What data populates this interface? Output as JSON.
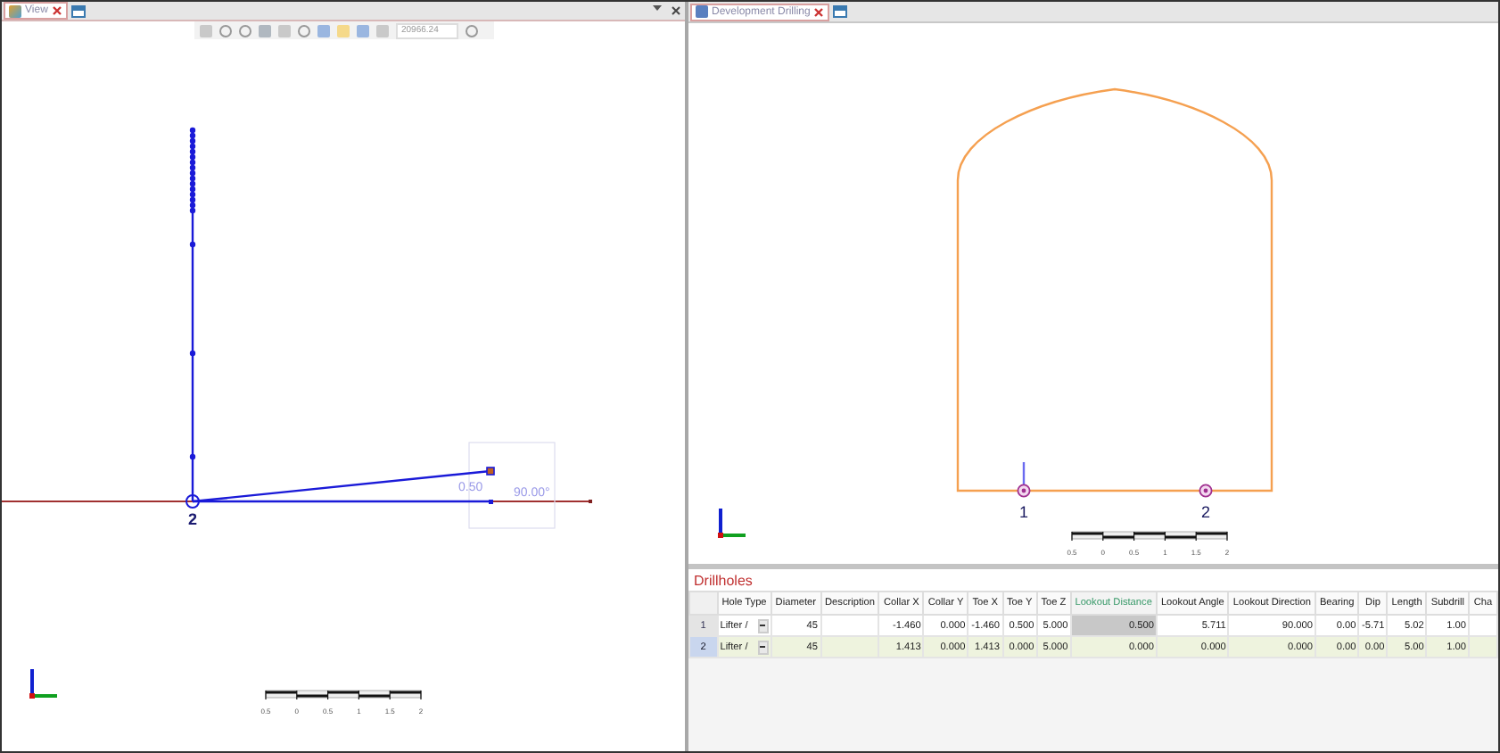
{
  "left_pane": {
    "tab": {
      "label": "View",
      "selected": true
    },
    "toolbar": {
      "scale": "20966.24"
    },
    "hole_label": "2",
    "distance_label": "0.50",
    "angle_label": "90.00°",
    "scale_bar": [
      "0.5",
      "0",
      "0.5",
      "1",
      "1.5",
      "2"
    ]
  },
  "right_pane": {
    "tab": {
      "label": "Development Drilling",
      "selected": true
    },
    "hole_labels": [
      "1",
      "2"
    ],
    "scale_bar": [
      "0.5",
      "0",
      "0.5",
      "1",
      "1.5",
      "2"
    ]
  },
  "drillholes": {
    "title": "Drillholes",
    "columns": [
      {
        "label": "Hole Type",
        "selected": false
      },
      {
        "label": "Diameter",
        "selected": false
      },
      {
        "label": "Description",
        "selected": false
      },
      {
        "label": "Collar X",
        "selected": false
      },
      {
        "label": "Collar Y",
        "selected": false
      },
      {
        "label": "Toe X",
        "selected": false
      },
      {
        "label": "Toe Y",
        "selected": false
      },
      {
        "label": "Toe Z",
        "selected": false
      },
      {
        "label": "Lookout Distance",
        "selected": true
      },
      {
        "label": "Lookout Angle",
        "selected": false
      },
      {
        "label": "Lookout Direction",
        "selected": false
      },
      {
        "label": "Bearing",
        "selected": false
      },
      {
        "label": "Dip",
        "selected": false
      },
      {
        "label": "Length",
        "selected": false
      },
      {
        "label": "Subdrill",
        "selected": false
      },
      {
        "label": "Cha",
        "selected": false
      }
    ],
    "rows": [
      {
        "number": "1",
        "selected": false,
        "cells": [
          "Lifter /",
          "45",
          "",
          "-1.460",
          "0.000",
          "-1.460",
          "0.500",
          "5.000",
          "0.500",
          "5.711",
          "90.000",
          "0.00",
          "-5.71",
          "5.02",
          "1.00",
          ""
        ]
      },
      {
        "number": "2",
        "selected": true,
        "cells": [
          "Lifter /",
          "45",
          "",
          "1.413",
          "0.000",
          "1.413",
          "0.000",
          "5.000",
          "0.000",
          "0.000",
          "0.000",
          "0.00",
          "0.00",
          "5.00",
          "1.00",
          ""
        ]
      }
    ]
  }
}
